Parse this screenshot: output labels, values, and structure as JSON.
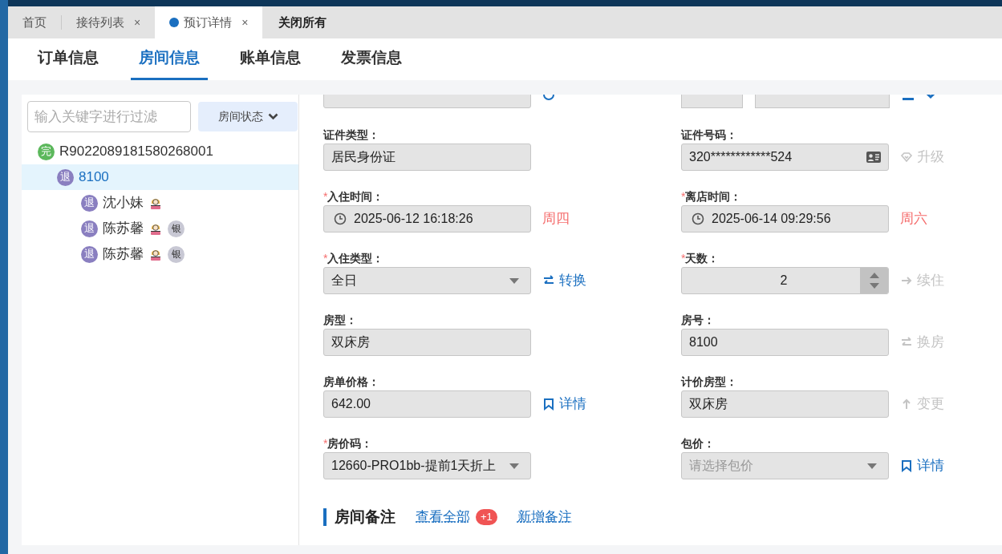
{
  "tabs": [
    {
      "label": "首页",
      "selected": false
    },
    {
      "label": "接待列表",
      "close": "×",
      "selected": false
    },
    {
      "label": "预订详情",
      "close": "×",
      "selected": true
    }
  ],
  "close_all": "关闭所有",
  "sub_tabs": [
    {
      "label": "订单信息",
      "selected": false
    },
    {
      "label": "房间信息",
      "selected": true
    },
    {
      "label": "账单信息",
      "selected": false
    },
    {
      "label": "发票信息",
      "selected": false
    }
  ],
  "filter": {
    "placeholder": "输入关键字进行过滤"
  },
  "status_button": "房间状态",
  "tree": [
    {
      "badge": "完",
      "color": "#5cb85c",
      "label": "R9022089181580268001",
      "selected": false,
      "children": [
        {
          "badge": "退",
          "color": "#8a7fc0",
          "label": "8100",
          "selected": true,
          "children": [
            {
              "badge": "退",
              "color": "#8a7fc0",
              "label": "沈小妹",
              "kind": "guest",
              "selected": false
            },
            {
              "badge": "退",
              "color": "#8a7fc0",
              "label": "陈苏馨",
              "kind": "guest",
              "selected": false,
              "tags": [
                "银"
              ]
            },
            {
              "badge": "退",
              "color": "#8a7fc0",
              "label": "陈苏馨",
              "kind": "guest",
              "selected": false,
              "tags": [
                "银"
              ]
            }
          ]
        }
      ]
    }
  ],
  "fields": [
    {
      "label": "证件类型：",
      "kind": "text",
      "value": "居民身份证"
    },
    {
      "label": "证件号码：",
      "kind": "id",
      "value": "320************524",
      "action": {
        "kind": "upgrade",
        "label": "升级",
        "disabled": true
      }
    },
    {
      "mark": "*",
      "label": "入住时间：",
      "kind": "datetime",
      "value": "2025-06-12 16:18:26",
      "weekday": "周四"
    },
    {
      "mark": "*",
      "label": "离店时间：",
      "kind": "datetime",
      "value": "2025-06-14 09:29:56",
      "weekday": "周六"
    },
    {
      "mark": "*",
      "label": "入住类型：",
      "kind": "select",
      "value": "全日",
      "action": {
        "kind": "swap",
        "label": "转换",
        "disabled": false
      }
    },
    {
      "mark": "*",
      "label": "天数：",
      "kind": "number",
      "value": "2",
      "action": {
        "kind": "forward",
        "label": "续住",
        "disabled": true
      }
    },
    {
      "label": "房型：",
      "kind": "text",
      "value": "双床房"
    },
    {
      "label": "房号：",
      "kind": "text",
      "value": "8100",
      "action": {
        "kind": "swap",
        "label": "换房",
        "disabled": true
      }
    },
    {
      "label": "房单价格：",
      "kind": "text",
      "value": "642.00",
      "action": {
        "kind": "bookmark",
        "label": "详情",
        "disabled": false
      }
    },
    {
      "label": "计价房型：",
      "kind": "text",
      "value": "双床房",
      "action": {
        "kind": "up",
        "label": "变更",
        "disabled": true
      }
    },
    {
      "mark": "*",
      "label": "房价码：",
      "kind": "select",
      "value": "12660-PRO1bb-提前1天折上"
    },
    {
      "label": "包价：",
      "kind": "select",
      "placeholder": "请选择包价",
      "action": {
        "kind": "bookmark",
        "label": "详情",
        "disabled": false
      }
    }
  ],
  "notes": {
    "title": "房间备注",
    "view_all": "查看全部",
    "count": "+1",
    "add": "新增备注"
  }
}
